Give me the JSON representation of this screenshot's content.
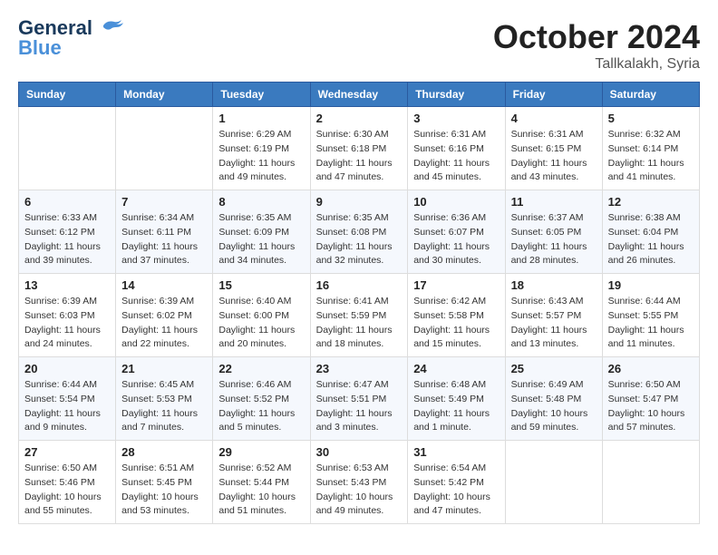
{
  "header": {
    "logo_general": "General",
    "logo_blue": "Blue",
    "month_title": "October 2024",
    "location": "Tallkalakh, Syria"
  },
  "calendar": {
    "columns": [
      "Sunday",
      "Monday",
      "Tuesday",
      "Wednesday",
      "Thursday",
      "Friday",
      "Saturday"
    ],
    "weeks": [
      [
        {
          "day": "",
          "sunrise": "",
          "sunset": "",
          "daylight": ""
        },
        {
          "day": "",
          "sunrise": "",
          "sunset": "",
          "daylight": ""
        },
        {
          "day": "1",
          "sunrise": "Sunrise: 6:29 AM",
          "sunset": "Sunset: 6:19 PM",
          "daylight": "Daylight: 11 hours and 49 minutes."
        },
        {
          "day": "2",
          "sunrise": "Sunrise: 6:30 AM",
          "sunset": "Sunset: 6:18 PM",
          "daylight": "Daylight: 11 hours and 47 minutes."
        },
        {
          "day": "3",
          "sunrise": "Sunrise: 6:31 AM",
          "sunset": "Sunset: 6:16 PM",
          "daylight": "Daylight: 11 hours and 45 minutes."
        },
        {
          "day": "4",
          "sunrise": "Sunrise: 6:31 AM",
          "sunset": "Sunset: 6:15 PM",
          "daylight": "Daylight: 11 hours and 43 minutes."
        },
        {
          "day": "5",
          "sunrise": "Sunrise: 6:32 AM",
          "sunset": "Sunset: 6:14 PM",
          "daylight": "Daylight: 11 hours and 41 minutes."
        }
      ],
      [
        {
          "day": "6",
          "sunrise": "Sunrise: 6:33 AM",
          "sunset": "Sunset: 6:12 PM",
          "daylight": "Daylight: 11 hours and 39 minutes."
        },
        {
          "day": "7",
          "sunrise": "Sunrise: 6:34 AM",
          "sunset": "Sunset: 6:11 PM",
          "daylight": "Daylight: 11 hours and 37 minutes."
        },
        {
          "day": "8",
          "sunrise": "Sunrise: 6:35 AM",
          "sunset": "Sunset: 6:09 PM",
          "daylight": "Daylight: 11 hours and 34 minutes."
        },
        {
          "day": "9",
          "sunrise": "Sunrise: 6:35 AM",
          "sunset": "Sunset: 6:08 PM",
          "daylight": "Daylight: 11 hours and 32 minutes."
        },
        {
          "day": "10",
          "sunrise": "Sunrise: 6:36 AM",
          "sunset": "Sunset: 6:07 PM",
          "daylight": "Daylight: 11 hours and 30 minutes."
        },
        {
          "day": "11",
          "sunrise": "Sunrise: 6:37 AM",
          "sunset": "Sunset: 6:05 PM",
          "daylight": "Daylight: 11 hours and 28 minutes."
        },
        {
          "day": "12",
          "sunrise": "Sunrise: 6:38 AM",
          "sunset": "Sunset: 6:04 PM",
          "daylight": "Daylight: 11 hours and 26 minutes."
        }
      ],
      [
        {
          "day": "13",
          "sunrise": "Sunrise: 6:39 AM",
          "sunset": "Sunset: 6:03 PM",
          "daylight": "Daylight: 11 hours and 24 minutes."
        },
        {
          "day": "14",
          "sunrise": "Sunrise: 6:39 AM",
          "sunset": "Sunset: 6:02 PM",
          "daylight": "Daylight: 11 hours and 22 minutes."
        },
        {
          "day": "15",
          "sunrise": "Sunrise: 6:40 AM",
          "sunset": "Sunset: 6:00 PM",
          "daylight": "Daylight: 11 hours and 20 minutes."
        },
        {
          "day": "16",
          "sunrise": "Sunrise: 6:41 AM",
          "sunset": "Sunset: 5:59 PM",
          "daylight": "Daylight: 11 hours and 18 minutes."
        },
        {
          "day": "17",
          "sunrise": "Sunrise: 6:42 AM",
          "sunset": "Sunset: 5:58 PM",
          "daylight": "Daylight: 11 hours and 15 minutes."
        },
        {
          "day": "18",
          "sunrise": "Sunrise: 6:43 AM",
          "sunset": "Sunset: 5:57 PM",
          "daylight": "Daylight: 11 hours and 13 minutes."
        },
        {
          "day": "19",
          "sunrise": "Sunrise: 6:44 AM",
          "sunset": "Sunset: 5:55 PM",
          "daylight": "Daylight: 11 hours and 11 minutes."
        }
      ],
      [
        {
          "day": "20",
          "sunrise": "Sunrise: 6:44 AM",
          "sunset": "Sunset: 5:54 PM",
          "daylight": "Daylight: 11 hours and 9 minutes."
        },
        {
          "day": "21",
          "sunrise": "Sunrise: 6:45 AM",
          "sunset": "Sunset: 5:53 PM",
          "daylight": "Daylight: 11 hours and 7 minutes."
        },
        {
          "day": "22",
          "sunrise": "Sunrise: 6:46 AM",
          "sunset": "Sunset: 5:52 PM",
          "daylight": "Daylight: 11 hours and 5 minutes."
        },
        {
          "day": "23",
          "sunrise": "Sunrise: 6:47 AM",
          "sunset": "Sunset: 5:51 PM",
          "daylight": "Daylight: 11 hours and 3 minutes."
        },
        {
          "day": "24",
          "sunrise": "Sunrise: 6:48 AM",
          "sunset": "Sunset: 5:49 PM",
          "daylight": "Daylight: 11 hours and 1 minute."
        },
        {
          "day": "25",
          "sunrise": "Sunrise: 6:49 AM",
          "sunset": "Sunset: 5:48 PM",
          "daylight": "Daylight: 10 hours and 59 minutes."
        },
        {
          "day": "26",
          "sunrise": "Sunrise: 6:50 AM",
          "sunset": "Sunset: 5:47 PM",
          "daylight": "Daylight: 10 hours and 57 minutes."
        }
      ],
      [
        {
          "day": "27",
          "sunrise": "Sunrise: 6:50 AM",
          "sunset": "Sunset: 5:46 PM",
          "daylight": "Daylight: 10 hours and 55 minutes."
        },
        {
          "day": "28",
          "sunrise": "Sunrise: 6:51 AM",
          "sunset": "Sunset: 5:45 PM",
          "daylight": "Daylight: 10 hours and 53 minutes."
        },
        {
          "day": "29",
          "sunrise": "Sunrise: 6:52 AM",
          "sunset": "Sunset: 5:44 PM",
          "daylight": "Daylight: 10 hours and 51 minutes."
        },
        {
          "day": "30",
          "sunrise": "Sunrise: 6:53 AM",
          "sunset": "Sunset: 5:43 PM",
          "daylight": "Daylight: 10 hours and 49 minutes."
        },
        {
          "day": "31",
          "sunrise": "Sunrise: 6:54 AM",
          "sunset": "Sunset: 5:42 PM",
          "daylight": "Daylight: 10 hours and 47 minutes."
        },
        {
          "day": "",
          "sunrise": "",
          "sunset": "",
          "daylight": ""
        },
        {
          "day": "",
          "sunrise": "",
          "sunset": "",
          "daylight": ""
        }
      ]
    ]
  }
}
